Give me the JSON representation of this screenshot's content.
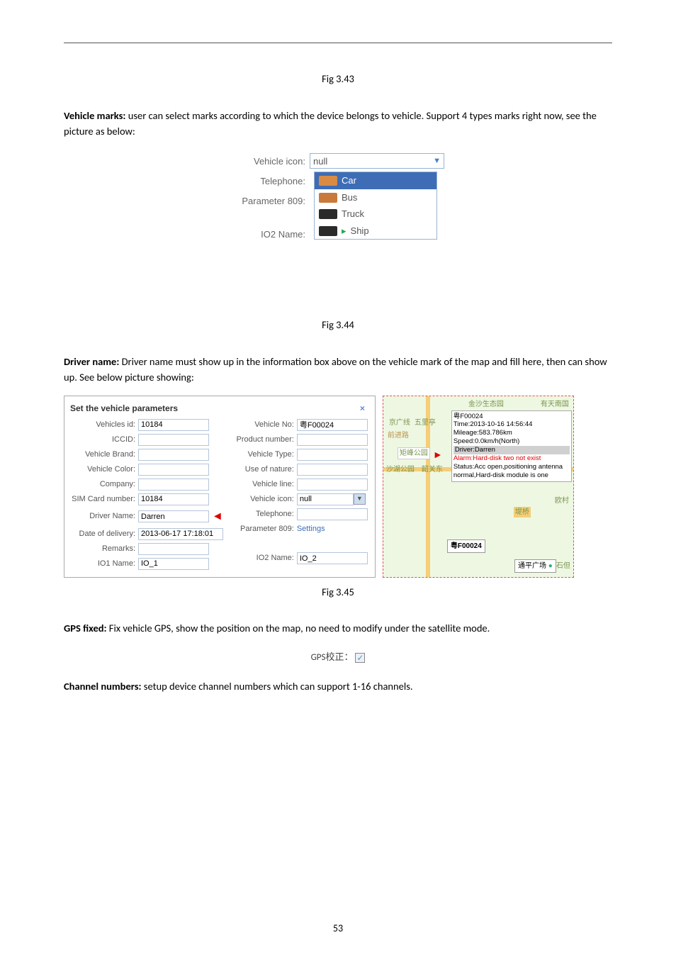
{
  "captions": {
    "fig343": "Fig 3.43",
    "fig344": "Fig 3.44",
    "fig345": "Fig 3.45"
  },
  "paragraphs": {
    "vehicle_marks_label": "Vehicle marks:",
    "vehicle_marks_body": " user can select marks according to which the device belongs to vehicle. Support 4 types marks right now, see the picture as below:",
    "driver_name_label": "Driver name:",
    "driver_name_body": " Driver name must show up in the information box above on the vehicle mark of the map and fill here, then can show up. See below picture showing:",
    "gps_fixed_label": "GPS fixed:",
    "gps_fixed_body": " Fix vehicle GPS, show the position on the map, no need to modify under the satellite mode.",
    "channel_numbers_label": "Channel numbers:",
    "channel_numbers_body": " setup device channel numbers which can support 1-16 channels."
  },
  "dropdown": {
    "vehicle_icon_label": "Vehicle icon:",
    "telephone_label": "Telephone:",
    "param_809_label": "Parameter 809:",
    "io2_label": "IO2 Name:",
    "selected": "null",
    "opt_car": "Car",
    "opt_bus": "Bus",
    "opt_truck": "Truck",
    "opt_ship": "Ship"
  },
  "form": {
    "title": "Set the vehicle parameters",
    "close": "×",
    "vehicles_id_label": "Vehicles id:",
    "vehicles_id_value": "10184",
    "vehicle_no_label": "Vehicle No:",
    "vehicle_no_value": "粤F00024",
    "iccid_label": "ICCID:",
    "product_number_label": "Product number:",
    "vehicle_brand_label": "Vehicle Brand:",
    "vehicle_type_label": "Vehicle Type:",
    "vehicle_color_label": "Vehicle Color:",
    "use_of_nature_label": "Use of nature:",
    "company_label": "Company:",
    "vehicle_line_label": "Vehicle line:",
    "sim_card_label": "SIM Card number:",
    "sim_card_value": "10184",
    "vehicle_icon_label": "Vehicle icon:",
    "vehicle_icon_value": "null",
    "driver_name_label": "Driver Name:",
    "driver_name_value": "Darren",
    "telephone_label": "Telephone:",
    "date_delivery_label": "Date of delivery:",
    "date_delivery_value": "2013-06-17 17:18:01",
    "param_809_label": "Parameter 809:",
    "param_809_link": "Settings",
    "remarks_label": "Remarks:",
    "io1_name_label": "IO1 Name:",
    "io1_name_value": "IO_1",
    "io2_name_label": "IO2 Name:",
    "io2_name_value": "IO_2"
  },
  "map": {
    "label1": "金沙生态园",
    "label2": "有天南国",
    "label3": "京广线",
    "label4": "五里亭",
    "label5": "韶关东",
    "label6": "沙湖公园",
    "label7": "矩峰公园",
    "label8": "前进路",
    "label9": "欧村",
    "label10": "堤桥",
    "label11": "石但",
    "info_plate": "粤F00024",
    "info_time": "Time:2013-10-16 14:56:44",
    "info_mileage": "Mileage:583.786km",
    "info_speed": "Speed:0.0km/h(North)",
    "info_driver": "Driver:Darren",
    "info_alarm": "Alarm:Hard-disk two not exist",
    "info_status": "Status:Acc open,positioning antenna normal,Hard-disk module is one",
    "plate_box": "粤F00024",
    "park_box": "通平广场"
  },
  "gps_label": "GPS校正：",
  "page_number": "53"
}
